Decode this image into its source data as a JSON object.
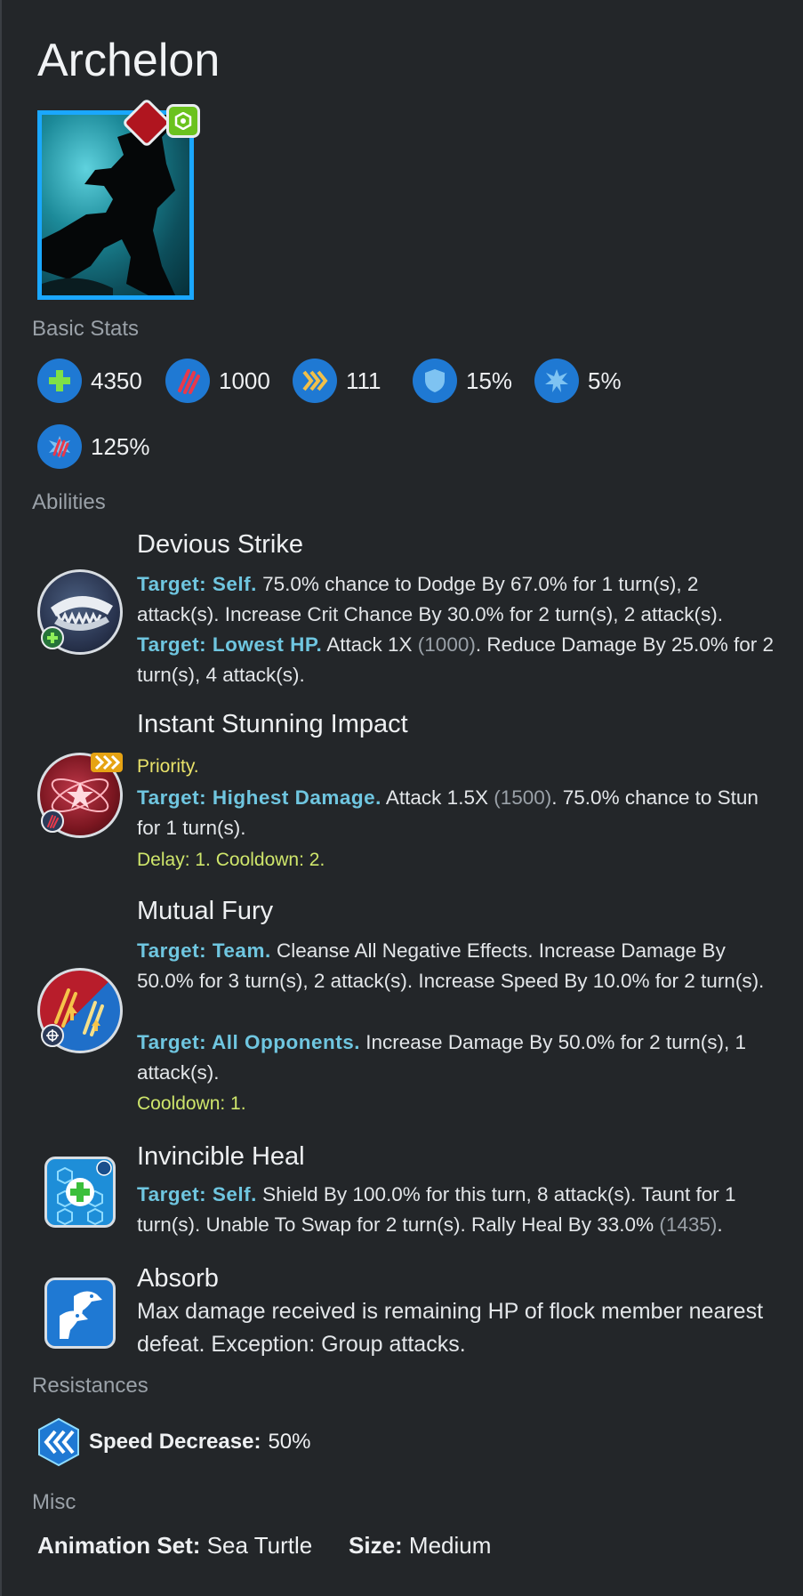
{
  "creature": {
    "name": "Archelon"
  },
  "sections": {
    "basic_stats": "Basic Stats",
    "abilities": "Abilities",
    "resistances": "Resistances",
    "misc": "Misc"
  },
  "stats": [
    {
      "icon": "health-icon",
      "value": "4350"
    },
    {
      "icon": "damage-icon",
      "value": "1000"
    },
    {
      "icon": "speed-icon",
      "value": "111"
    },
    {
      "icon": "armor-icon",
      "value": "15%"
    },
    {
      "icon": "crit-chance-icon",
      "value": "5%"
    },
    {
      "icon": "crit-damage-icon",
      "value": "125%"
    }
  ],
  "abilities": {
    "devious": {
      "name": "Devious Strike",
      "t1": "Target: Self.",
      "d1": "75.0% chance to Dodge By 67.0% for 1 turn(s), 2 attack(s). Increase Crit Chance By 30.0% for 2 turn(s), 2 attack(s).",
      "t2": "Target: Lowest HP.",
      "d2a": "Attack 1X",
      "d2b": "(1000)",
      "d2c": ". Reduce Damage By 25.0% for 2 turn(s), 4 attack(s)."
    },
    "stunning": {
      "name": "Instant Stunning Impact",
      "priority": "Priority.",
      "t1": "Target: Highest Damage.",
      "d1a": "Attack 1.5X",
      "d1b": "(1500)",
      "d1c": ". 75.0% chance to Stun for 1 turn(s).",
      "timing": "Delay: 1. Cooldown: 2."
    },
    "fury": {
      "name": "Mutual Fury",
      "t1": "Target: Team.",
      "d1": "Cleanse All Negative Effects. Increase Damage By 50.0% for 3 turn(s), 2 attack(s). Increase Speed By 10.0% for 2 turn(s).",
      "t2": "Target: All Opponents.",
      "d2": "Increase Damage By 50.0% for 2 turn(s), 1 attack(s).",
      "timing": "Cooldown: 1."
    },
    "heal": {
      "name": "Invincible Heal",
      "t1": "Target: Self.",
      "d1a": "Shield By 100.0% for this turn, 8 attack(s). Taunt for 1 turn(s). Unable To Swap for 2 turn(s). Rally Heal By 33.0%",
      "d1b": "(1435)",
      "d1c": "."
    },
    "absorb": {
      "name": "Absorb",
      "desc": "Max damage received is remaining HP of flock member nearest defeat. Exception: Group attacks."
    }
  },
  "resistance": {
    "label": "Speed Decrease:",
    "value": "50%"
  },
  "misc": {
    "anim_label": "Animation Set:",
    "anim_value": "Sea Turtle",
    "size_label": "Size:",
    "size_value": "Medium"
  },
  "colors": {
    "background": "#232629",
    "target": "#6fc6e0",
    "stat_circle": "#1f79d3",
    "priority": "#e9e26a",
    "timing": "#cfe66b"
  }
}
